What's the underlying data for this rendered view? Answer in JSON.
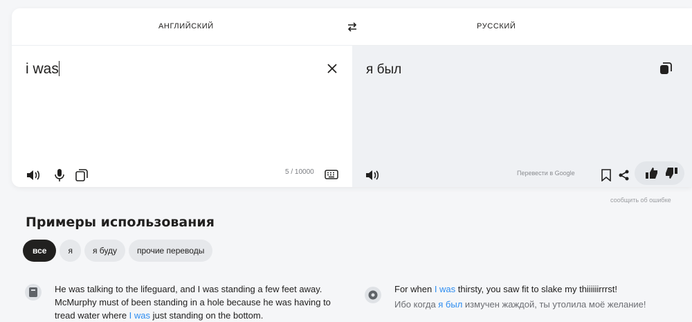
{
  "lang_bar": {
    "source_lang": "АНГЛИЙСКИЙ",
    "target_lang": "РУССКИЙ",
    "swap_icon": "swap-arrows-icon"
  },
  "source": {
    "text": "i was",
    "counter": "5 / 10000",
    "icons": [
      "speaker-icon",
      "microphone-icon",
      "copy-icon",
      "keyboard-icon",
      "close-icon"
    ]
  },
  "target": {
    "text": "я был",
    "google_link": "Перевести в Google",
    "icons": [
      "speaker-icon",
      "bookmark-icon",
      "share-icon",
      "thumbs-up-icon",
      "thumbs-down-icon",
      "copy-icon"
    ]
  },
  "report_link": "сообщить об ошибке",
  "examples": {
    "title": "Примеры использования",
    "chips": [
      "все",
      "я",
      "я буду",
      "прочие переводы"
    ],
    "left": {
      "icon": "book-icon",
      "line1": "He was talking to the lifeguard, and I was standing a few feet away.",
      "line2": "McMurphy must of been standing in a hole because he was having to",
      "line3_pre": "tread water where ",
      "line3_hl": "I was",
      "line3_post": " just standing on the bottom."
    },
    "right": {
      "icon": "film-reel-icon",
      "en_pre": "For when ",
      "en_hl": "I was",
      "en_post": " thirsty, you saw fit to slake my thiiiiiirrrst!",
      "ru_pre": "Ибо когда ",
      "ru_hl": "я был",
      "ru_post": " измучен жаждой, ты утолила моё желание!"
    }
  },
  "colors": {
    "accent_link": "#2c8cf0",
    "target_bg": "#eff1f4",
    "chip_active": "#21201f"
  }
}
